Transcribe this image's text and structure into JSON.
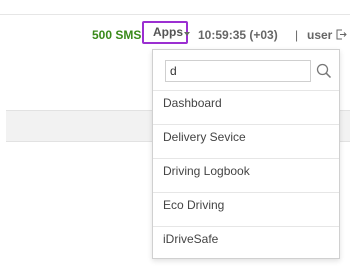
{
  "header": {
    "sms_balance": "500 SMS",
    "apps_label": "Apps",
    "clock": "10:59:35 (+03)",
    "separator": "|",
    "user": "user"
  },
  "apps_dropdown": {
    "search_value": "d",
    "items": [
      {
        "label": "Dashboard"
      },
      {
        "label": "Delivery Sevice"
      },
      {
        "label": "Driving Logbook"
      },
      {
        "label": "Eco Driving"
      },
      {
        "label": "iDriveSafe"
      }
    ]
  },
  "icons": {
    "apps_caret": "caret-down-icon",
    "logout": "logout-icon",
    "search": "search-icon"
  },
  "colors": {
    "sms_green": "#3a8a1a",
    "apps_highlight": "#9b2fd1"
  }
}
